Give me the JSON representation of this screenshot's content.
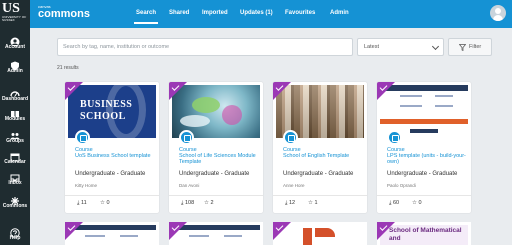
{
  "sidebar": {
    "logo_main": "US",
    "logo_sub": "UNIVERSITY OF SUSSEX",
    "items": [
      {
        "label": "Account",
        "icon": "account-icon"
      },
      {
        "label": "Admin",
        "icon": "admin-icon"
      },
      {
        "label": "Dashboard",
        "icon": "dashboard-icon"
      },
      {
        "label": "Modules",
        "icon": "modules-icon"
      },
      {
        "label": "Groups",
        "icon": "groups-icon"
      },
      {
        "label": "Calendar",
        "icon": "calendar-icon"
      },
      {
        "label": "Inbox",
        "icon": "inbox-icon"
      },
      {
        "label": "Commons",
        "icon": "commons-icon"
      },
      {
        "label": "Help",
        "icon": "help-icon"
      }
    ]
  },
  "topbar": {
    "brand_small": "canvas",
    "brand_big": "commons",
    "tabs": [
      "Search",
      "Shared",
      "Imported",
      "Updates (1)",
      "Favourites",
      "Admin"
    ]
  },
  "search": {
    "placeholder": "Search by tag, name, institution or outcome",
    "sort_value": "Latest",
    "filter_label": "Filter",
    "results": "21 results"
  },
  "colors": {
    "accent": "#1592d4",
    "sidebar": "#1f2c30",
    "check": "#9b38b5"
  },
  "cards": [
    {
      "type": "Course",
      "title": "UoS Business School template",
      "level": "Undergraduate - Graduate",
      "author": "Kitty Home",
      "downloads": "11",
      "favourites": "0",
      "thumb_text": "BUSINESS SCHOOL"
    },
    {
      "type": "Course",
      "title": "School of Life Sciences Module Template",
      "level": "Undergraduate - Graduate",
      "author": "Dan Avoni",
      "downloads": "108",
      "favourites": "2"
    },
    {
      "type": "Course",
      "title": "School of English Template",
      "level": "Undergraduate - Graduate",
      "author": "Anne Hore",
      "downloads": "12",
      "favourites": "1"
    },
    {
      "type": "Course",
      "title": "LPS template (units - build-your-own)",
      "level": "Undergraduate - Graduate",
      "author": "Paolo Oprandi",
      "downloads": "60",
      "favourites": "0"
    }
  ],
  "bottom_cards": [
    {
      "thumb_text": ""
    },
    {
      "thumb_text": ""
    },
    {
      "thumb_text": ""
    },
    {
      "thumb_text": "School of Mathematical and"
    }
  ]
}
